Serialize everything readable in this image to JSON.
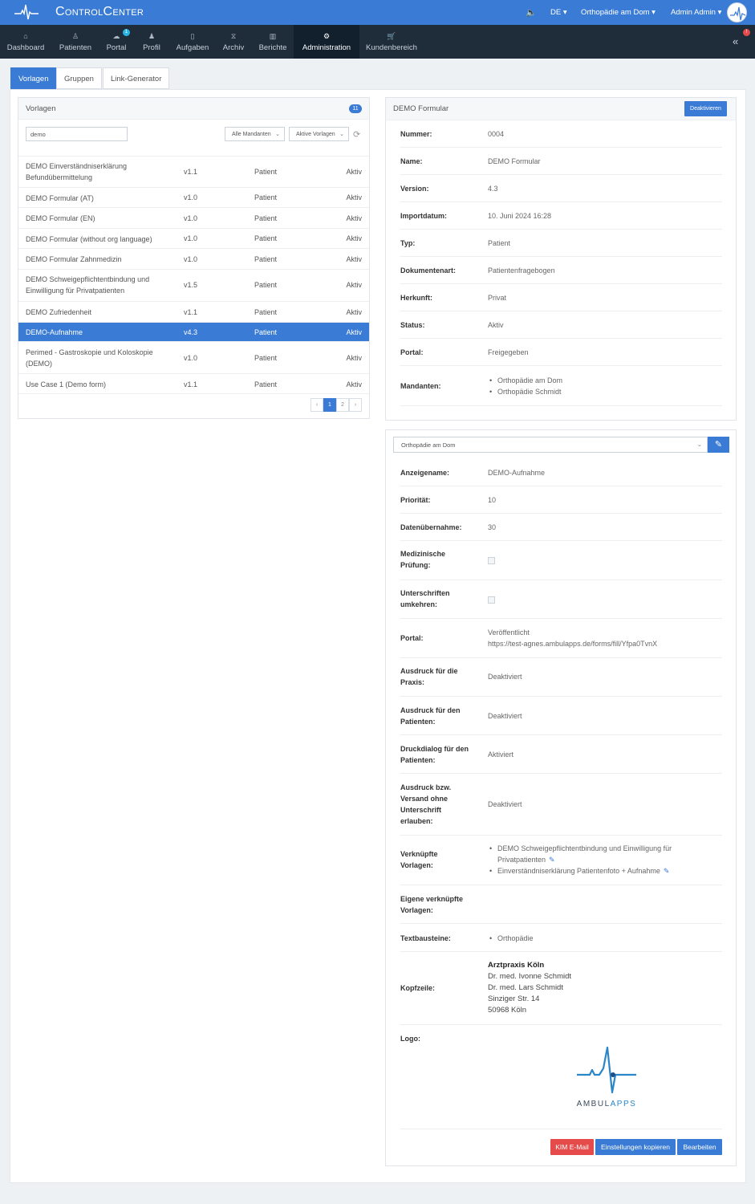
{
  "app": {
    "brand": "ControlCenter"
  },
  "topbar": {
    "lang": "DE",
    "org": "Orthopädie am Dom",
    "user": "Admin Admin"
  },
  "nav": {
    "items": [
      {
        "label": "Dashboard",
        "icon": "home-icon"
      },
      {
        "label": "Patienten",
        "icon": "user-icon"
      },
      {
        "label": "Portal",
        "icon": "cloud-icon",
        "badge": "1"
      },
      {
        "label": "Profil",
        "icon": "profile-icon"
      },
      {
        "label": "Aufgaben",
        "icon": "task-icon"
      },
      {
        "label": "Archiv",
        "icon": "archive-icon"
      },
      {
        "label": "Berichte",
        "icon": "chart-icon"
      },
      {
        "label": "Administration",
        "icon": "gear-icon"
      },
      {
        "label": "Kundenbereich",
        "icon": "cart-icon"
      }
    ],
    "active": "Administration",
    "notification_badge": "!"
  },
  "tabs": [
    {
      "label": "Vorlagen"
    },
    {
      "label": "Gruppen"
    },
    {
      "label": "Link-Generator"
    }
  ],
  "list_panel": {
    "title": "Vorlagen",
    "count": "11",
    "search_value": "demo",
    "filter_mandant": "Alle Mandanten",
    "filter_status": "Aktive Vorlagen",
    "rows": [
      {
        "name_l1": "DEMO Einverständniserklärung",
        "name_l2": "Befundübermittelung",
        "version": "v1.1",
        "type": "Patient",
        "status": "Aktiv"
      },
      {
        "name_l1": "DEMO Formular (AT)",
        "name_l2": "",
        "version": "v1.0",
        "type": "Patient",
        "status": "Aktiv"
      },
      {
        "name_l1": "DEMO Formular (EN)",
        "name_l2": "",
        "version": "v1.0",
        "type": "Patient",
        "status": "Aktiv"
      },
      {
        "name_l1": "DEMO Formular (without org language)",
        "name_l2": "",
        "version": "v1.0",
        "type": "Patient",
        "status": "Aktiv"
      },
      {
        "name_l1": "DEMO Formular Zahnmedizin",
        "name_l2": "",
        "version": "v1.0",
        "type": "Patient",
        "status": "Aktiv"
      },
      {
        "name_l1": "DEMO Schweigepflichtentbindung und",
        "name_l2": "Einwilligung für Privatpatienten",
        "version": "v1.5",
        "type": "Patient",
        "status": "Aktiv"
      },
      {
        "name_l1": "DEMO Zufriedenheit",
        "name_l2": "",
        "version": "v1.1",
        "type": "Patient",
        "status": "Aktiv"
      },
      {
        "name_l1": "DEMO-Aufnahme",
        "name_l2": "",
        "version": "v4.3",
        "type": "Patient",
        "status": "Aktiv"
      },
      {
        "name_l1": "Perimed - Gastroskopie und Koloskopie",
        "name_l2": "(DEMO)",
        "version": "v1.0",
        "type": "Patient",
        "status": "Aktiv"
      },
      {
        "name_l1": "Use Case 1 (Demo form)",
        "name_l2": "",
        "version": "v1.1",
        "type": "Patient",
        "status": "Aktiv"
      }
    ],
    "pagination": {
      "prev": "‹",
      "pages": [
        "1",
        "2"
      ],
      "next": "›",
      "current": "1"
    }
  },
  "detail_panel": {
    "title": "DEMO Formular",
    "deactivate_label": "Deaktivieren",
    "fields": [
      {
        "label": "Nummer:",
        "value": "0004"
      },
      {
        "label": "Name:",
        "value": "DEMO Formular"
      },
      {
        "label": "Version:",
        "value": "4.3"
      },
      {
        "label": "Importdatum:",
        "value": "10. Juni 2024 16:28"
      },
      {
        "label": "Typ:",
        "value": "Patient"
      },
      {
        "label": "Dokumentenart:",
        "value": "Patientenfragebogen"
      },
      {
        "label": "Herkunft:",
        "value": "Privat"
      },
      {
        "label": "Status:",
        "value": "Aktiv"
      },
      {
        "label": "Portal:",
        "value": "Freigegeben"
      }
    ],
    "mandanten": {
      "label": "Mandanten:",
      "items": [
        "Orthopädie am Dom",
        "Orthopädie Schmidt"
      ]
    }
  },
  "settings_panel": {
    "mandant_select": "Orthopädie am Dom",
    "anzeigename": {
      "label": "Anzeigename:",
      "value": "DEMO-Aufnahme"
    },
    "prioritaet": {
      "label": "Priorität:",
      "value": "10"
    },
    "datenuebernahme": {
      "label": "Datenübernahme:",
      "value": "30"
    },
    "med_pruefung": {
      "label_l1": "Medizinische",
      "label_l2": "Prüfung:",
      "checked": false
    },
    "unterschriften": {
      "label_l1": "Unterschriften",
      "label_l2": "umkehren:",
      "checked": false
    },
    "portal": {
      "label": "Portal:",
      "value_l1": "Veröffentlicht",
      "value_l2": "https://test-agnes.ambulapps.de/forms/fill/Yfpa0TvnX"
    },
    "ausdruck_praxis": {
      "label_l1": "Ausdruck für die",
      "label_l2": "Praxis:",
      "value": "Deaktiviert"
    },
    "ausdruck_patienten": {
      "label_l1": "Ausdruck für den",
      "label_l2": "Patienten:",
      "value": "Deaktiviert"
    },
    "druckdialog": {
      "label_l1": "Druckdialog für den",
      "label_l2": "Patienten:",
      "value": "Aktiviert"
    },
    "versand": {
      "label_l1": "Ausdruck bzw.",
      "label_l2": "Versand ohne",
      "label_l3": "Unterschrift",
      "label_l4": "erlauben:",
      "value": "Deaktiviert"
    },
    "verknuepfte": {
      "label_l1": "Verknüpfte",
      "label_l2": "Vorlagen:",
      "item1_l1": "DEMO Schweigepflichtentbindung und Einwilligung für",
      "item1_l2": "Privatpatienten",
      "item2": "Einverständniserklärung Patientenfoto + Aufnahme"
    },
    "eigene": {
      "label_l1": "Eigene verknüpfte",
      "label_l2": "Vorlagen:"
    },
    "textbausteine": {
      "label": "Textbausteine:",
      "items": [
        "Orthopädie"
      ]
    },
    "kopfzeile": {
      "label": "Kopfzeile:",
      "lines": [
        "Arztpraxis Köln",
        "Dr. med. Ivonne Schmidt",
        "Dr. med. Lars Schmidt",
        "Sinziger Str. 14",
        "50968 Köln"
      ]
    },
    "logo": {
      "label": "Logo:",
      "text_dark": "AMBUL",
      "text_light": "APPS"
    },
    "buttons": {
      "kim": "KIM E-Mail",
      "copy": "Einstellungen kopieren",
      "edit": "Bearbeiten"
    }
  },
  "colors": {
    "primary": "#3a7bd5",
    "nav_bg": "#1f2c3a",
    "danger": "#e54b4b"
  }
}
